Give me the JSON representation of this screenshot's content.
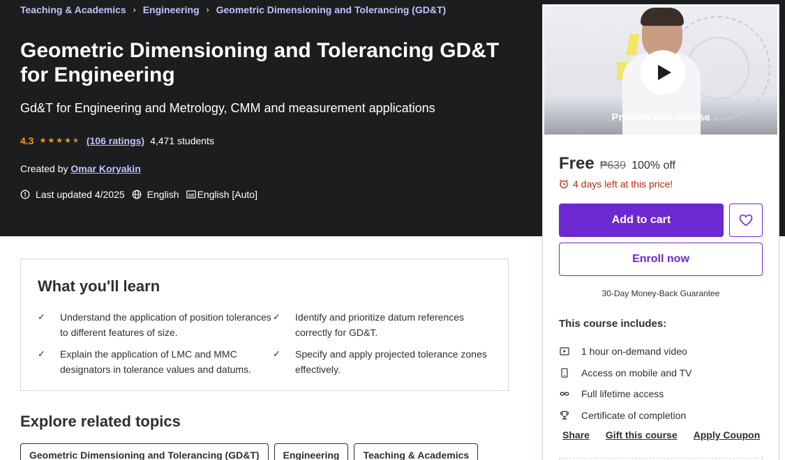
{
  "breadcrumb": [
    {
      "label": "Teaching & Academics"
    },
    {
      "label": "Engineering"
    },
    {
      "label": "Geometric Dimensioning and Tolerancing (GD&T)"
    }
  ],
  "breadcrumb_separator": "›",
  "course": {
    "title": "Geometric Dimensioning and Tolerancing GD&T for Engineering",
    "subtitle": "Gd&T for Engineering and Metrology, CMM and measurement applications",
    "rating": "4.3",
    "rating_value": 4.3,
    "rating_max": 5,
    "ratings_count_label": "(106 ratings)",
    "students": "4,471 students",
    "created_by_label": "Created by",
    "author": "Omar Koryakin",
    "last_updated": "Last updated 4/2025",
    "language": "English",
    "captions": "English [Auto]"
  },
  "sidebar": {
    "preview_label": "Preview this course",
    "price": "Free",
    "original_price": "₱639",
    "discount": "100% off",
    "timer_text": "4 days left at this price!",
    "add_to_cart": "Add to cart",
    "enroll_now": "Enroll now",
    "guarantee": "30-Day Money-Back Guarantee",
    "includes_title": "This course includes:",
    "includes": [
      {
        "icon": "video-icon",
        "label": "1 hour on-demand video"
      },
      {
        "icon": "mobile-icon",
        "label": "Access on mobile and TV"
      },
      {
        "icon": "infinity-icon",
        "label": "Full lifetime access"
      },
      {
        "icon": "trophy-icon",
        "label": "Certificate of completion"
      }
    ],
    "links": {
      "share": "Share",
      "gift": "Gift this course",
      "coupon": "Apply Coupon"
    }
  },
  "learn": {
    "title": "What you'll learn",
    "items": [
      "Understand the application of position tolerances to different features of size.",
      "Identify and prioritize datum references correctly for GD&T.",
      "Explain the application of LMC and MMC designators in tolerance values and datums.",
      "Specify and apply projected tolerance zones effectively."
    ]
  },
  "related": {
    "title": "Explore related topics",
    "topics": [
      "Geometric Dimensioning and Tolerancing (GD&T)",
      "Engineering",
      "Teaching & Academics"
    ]
  },
  "colors": {
    "hero_bg": "#1c1d1f",
    "accent_purple": "#6d28d2",
    "link_lavender": "#c0c4fc",
    "star_orange": "#f69c08",
    "timer_red": "#b32d0f"
  }
}
